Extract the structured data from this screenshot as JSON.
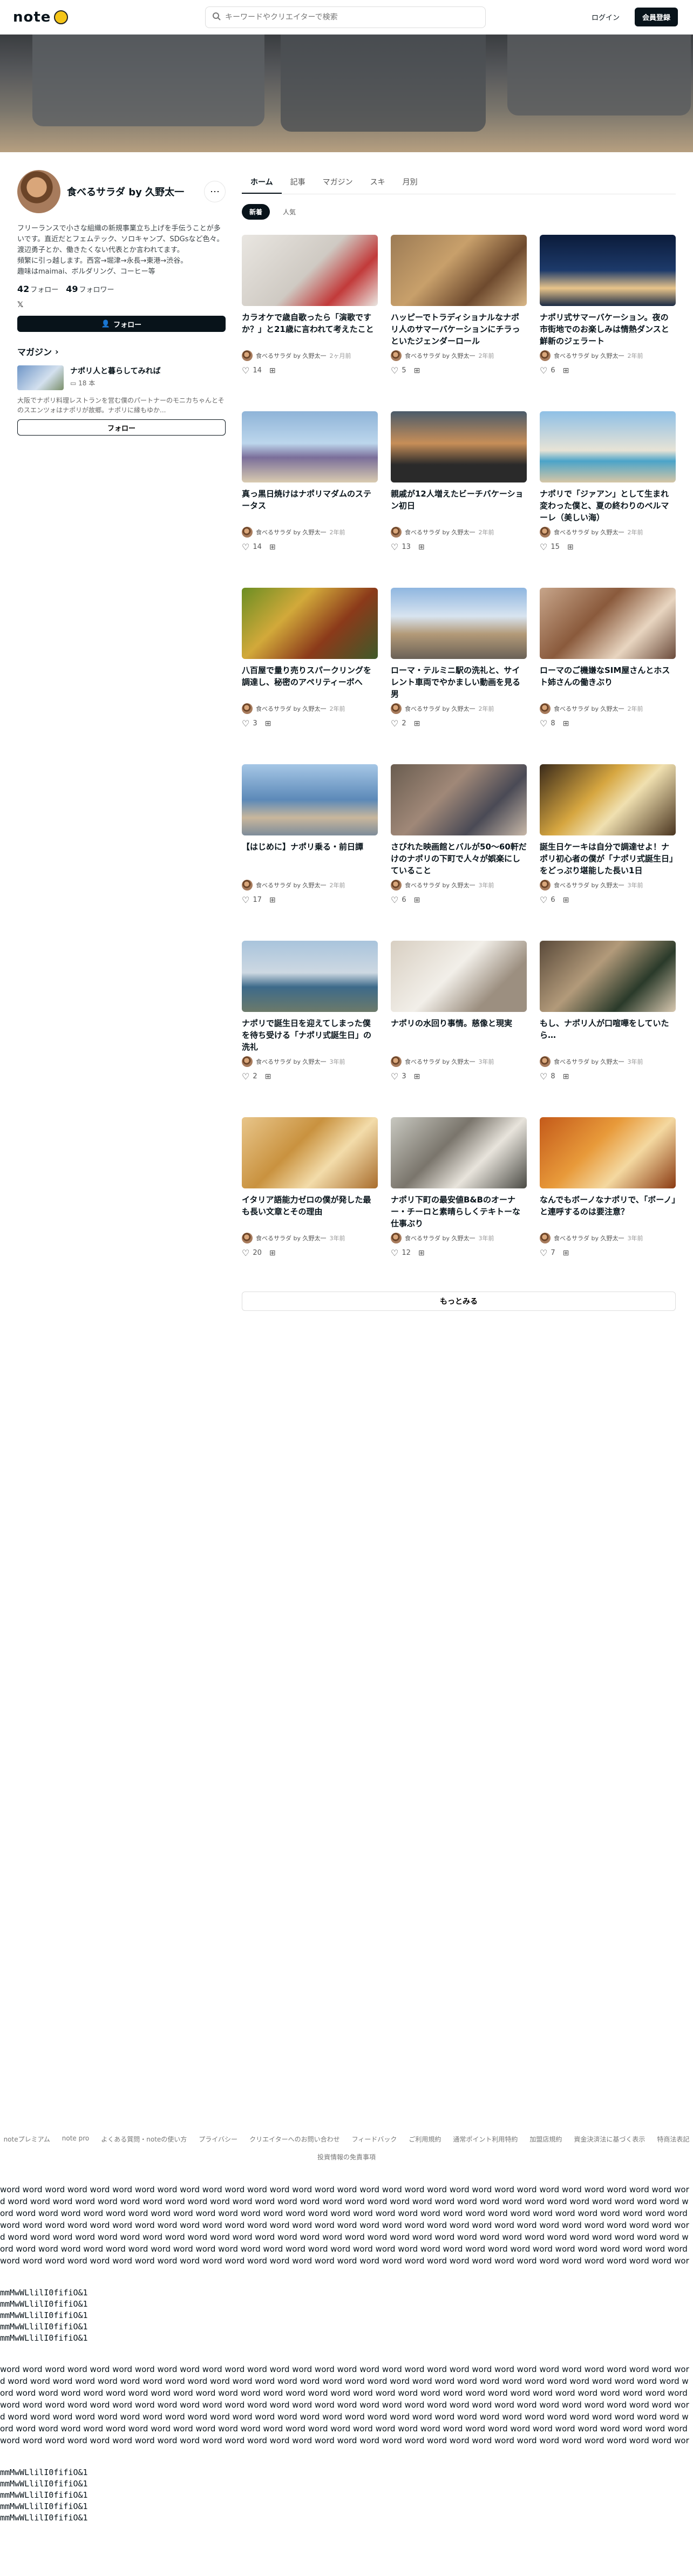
{
  "header": {
    "logo_text": "note",
    "search_placeholder": "キーワードやクリエイターで検索",
    "login_label": "ログイン",
    "signup_label": "会員登録"
  },
  "profile": {
    "name": "食べるサラダ by 久野太一",
    "more_icon": "ellipsis-icon",
    "bio": "フリーランスで小さな組織の新規事業立ち上げを手伝うことが多いです。直近だとフェムテック、ソロキャンプ、SDGsなど色々。\n渡辺勇子とか、働きたくない代表とか言われてます。\n頻繁に引っ越します。西宮→堀津→永長→東港→渋谷。\n趣味はmaimai、ボルダリング、コーヒー等",
    "following_count": "42",
    "following_label": "フォロー",
    "followers_count": "49",
    "followers_label": "フォロワー",
    "x_label": "𝕏",
    "follow_label": "フォロー"
  },
  "magazine": {
    "section_title": "マガジン",
    "name": "ナポリ人と暮らしてみれば",
    "count": "18 本",
    "description": "大阪でナポリ料理レストランを営む僕のパートナーのモニカちゃんとそのスエンツォはナポリが故郷。ナポリに縁もゆか...",
    "follow_label": "フォロー"
  },
  "tabs": [
    "ホーム",
    "記事",
    "マガジン",
    "スキ",
    "月別"
  ],
  "subtabs": [
    "新着",
    "人気"
  ],
  "articles": [
    {
      "title": "カラオケで歳自歌ったら「演歌ですか？」と21歳に言われて考えたこと",
      "author": "食べるサラダ by 久野太一",
      "date": "2ヶ月前",
      "likes": "14"
    },
    {
      "title": "ハッピーでトラディショナルなナポリ人のサマーバケーションにチラっといたジェンダーロール",
      "author": "食べるサラダ by 久野太一",
      "date": "2年前",
      "likes": "5"
    },
    {
      "title": "ナポリ式サマーバケーション。夜の市街地でのお楽しみは情熱ダンスと鮮新のジェラート",
      "author": "食べるサラダ by 久野太一",
      "date": "2年前",
      "likes": "6"
    },
    {
      "title": "真っ黒日焼けはナポリマダムのステータス",
      "author": "食べるサラダ by 久野太一",
      "date": "2年前",
      "likes": "14"
    },
    {
      "title": "親戚が12人増えたビーチバケーション初日",
      "author": "食べるサラダ by 久野太一",
      "date": "2年前",
      "likes": "13"
    },
    {
      "title": "ナポリで「ジァアン」として生まれ変わった僕と、夏の終わりのベルマーレ（美しい海）",
      "author": "食べるサラダ by 久野太一",
      "date": "2年前",
      "likes": "15"
    },
    {
      "title": "八百屋で量り売りスパークリングを調達し、秘密のアペリティーボへ",
      "author": "食べるサラダ by 久野太一",
      "date": "2年前",
      "likes": "3"
    },
    {
      "title": "ローマ・テルミニ駅の洗礼と、サイレント車両でやかましい動画を見る男",
      "author": "食べるサラダ by 久野太一",
      "date": "2年前",
      "likes": "2"
    },
    {
      "title": "ローマのご機嫌なSIM屋さんとホスト姉さんの働きぶり",
      "author": "食べるサラダ by 久野太一",
      "date": "2年前",
      "likes": "8"
    },
    {
      "title": "【はじめに】ナポリ乗る・前日譚",
      "author": "食べるサラダ by 久野太一",
      "date": "2年前",
      "likes": "17"
    },
    {
      "title": "さびれた映画館とバルが50〜60軒だけのナポリの下町で人々が娯楽にしていること",
      "author": "食べるサラダ by 久野太一",
      "date": "3年前",
      "likes": "6"
    },
    {
      "title": "誕生日ケーキは自分で調達せよ！ナポリ初心者の僕が「ナポリ式誕生日」をどっぷり堪能した長い1日",
      "author": "食べるサラダ by 久野太一",
      "date": "3年前",
      "likes": "6"
    },
    {
      "title": "ナポリで誕生日を迎えてしまった僕を待ち受ける「ナポリ式誕生日」の洗礼",
      "author": "食べるサラダ by 久野太一",
      "date": "3年前",
      "likes": "2"
    },
    {
      "title": "ナポリの水回り事情。慈像と現実",
      "author": "食べるサラダ by 久野太一",
      "date": "3年前",
      "likes": "3"
    },
    {
      "title": "もし、ナポリ人が口喧嘩をしていたら…",
      "author": "食べるサラダ by 久野太一",
      "date": "3年前",
      "likes": "8"
    },
    {
      "title": "イタリア語能力ゼロの僕が発した最も長い文章とその理由",
      "author": "食べるサラダ by 久野太一",
      "date": "3年前",
      "likes": "20"
    },
    {
      "title": "ナポリ下町の最安値B&Bのオーナー・チーロと素晴らしくテキトーな仕事ぶり",
      "author": "食べるサラダ by 久野太一",
      "date": "3年前",
      "likes": "12"
    },
    {
      "title": "なんでもボーノなナポリで、「ボーノ」と連呼するのは要注意？",
      "author": "食べるサラダ by 久野太一",
      "date": "3年前",
      "likes": "7"
    }
  ],
  "more_label": "もっとみる",
  "footer": {
    "links": [
      "noteプレミアム",
      "note pro",
      "よくある質問・noteの使い方",
      "プライバシー",
      "クリエイターへのお問い合わせ",
      "フィードバック",
      "ご利用規約",
      "通常ポイント利用特約",
      "加盟店規約",
      "資金決済法に基づく表示",
      "特商法表記"
    ],
    "second_line": "投資情報の免責事項"
  },
  "filler": {
    "words": "word word word word word word word word word word word word word word word word word word word word word word word word word word word word word word word word word word word word word word word word word word word word word word word word word word word word word word word word word word word word word word word word word word word word word word word word word word word word word word word word word word word word word word word word word word word word word word word word word word word word word word word word word word word word word word word word word word word word word word word word word word word word word word word word word word word word word word word word word word word word word word word word word word word word word word word word word word word word word word word word word word word word word word word word word word word word word word word word word word word word word word word word word word word word word word word word word word word word word word word word word word word word word word word word word word word word word word word word word word word word word word word word word word word word word word word word word word word word word",
    "lines": [
      "mmMwWLlilI0fifiO&1",
      "mmMwWLlilI0fifiO&1",
      "mmMwWLlilI0fifiO&1",
      "mmMwWLlilI0fifiO&1",
      "mmMwWLlilI0fifiO&1"
    ],
    "lines2": [
      "mmMwWLlilI0fifiO&1",
      "mmMwWLlilI0fifiO&1",
      "mmMwWLlilI0fifiO&1",
      "mmMwWLlilI0fifiO&1",
      "mmMwWLlilI0fifiO&1"
    ]
  }
}
